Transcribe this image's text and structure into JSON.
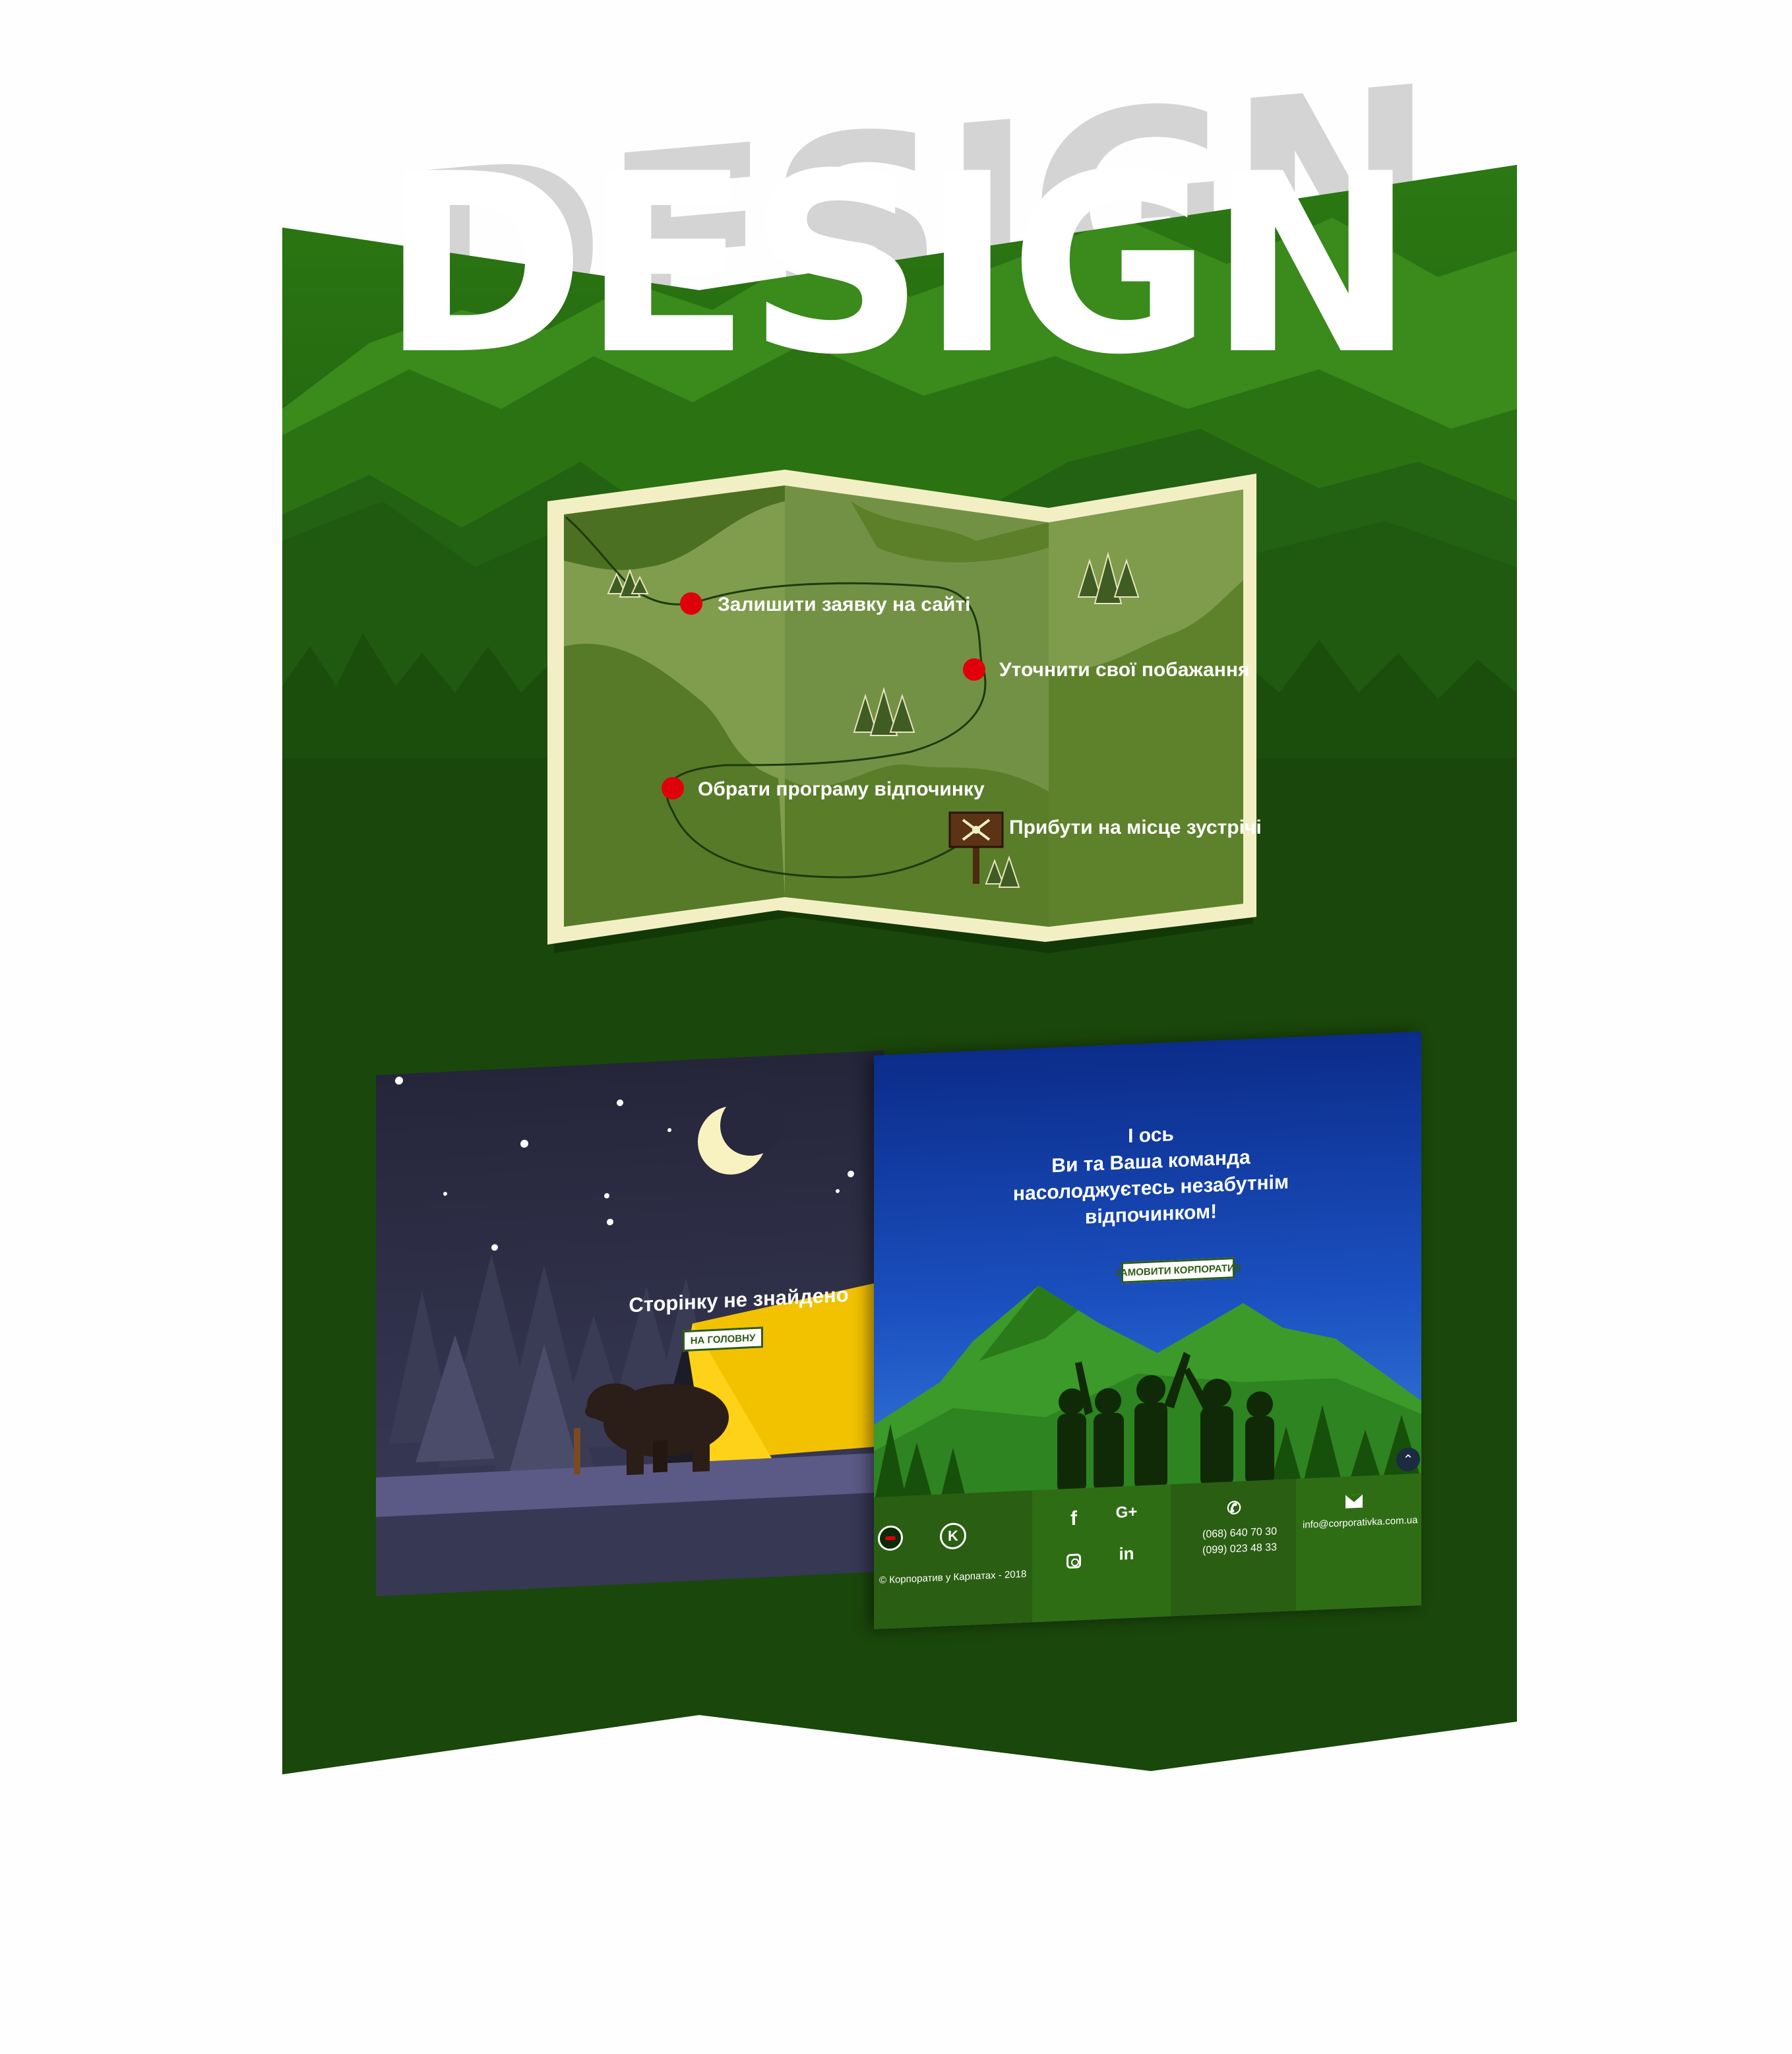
{
  "title": {
    "text": "DESIGN"
  },
  "colors": {
    "forest_dark": "#1d4a0c",
    "forest_mid": "#2f7a17",
    "map_paper": "#7a9a4a",
    "route_dot": "#e0000c",
    "button_border": "#2f5b16"
  },
  "map": {
    "steps": [
      {
        "label": "Залишити заявку на сайті"
      },
      {
        "label": "Уточнити свої побажання"
      },
      {
        "label": "Обрати програму відпочинку"
      },
      {
        "label": "Прибути на місце зустрічі"
      }
    ]
  },
  "page_404": {
    "heading": "Сторінку не знайдено",
    "button_label": "НА ГОЛОВНУ"
  },
  "page_final": {
    "heading_lines": [
      "І ось",
      "Ви та Ваша команда",
      "насолоджуєтесь незабутнім",
      "відпочинком!"
    ],
    "button_label": "ЗАМОВИТИ КОРПОРАТИВ",
    "footer": {
      "copyright": "© Корпоратив у Карпатах - 2018",
      "logo_letters": "K",
      "phones": [
        "(068) 640 70 30",
        "(099) 023 48 33"
      ],
      "email": "info@corporativka.com.ua",
      "social_icons": [
        "facebook-icon",
        "google-plus-icon",
        "instagram-icon",
        "linkedin-icon"
      ]
    }
  }
}
